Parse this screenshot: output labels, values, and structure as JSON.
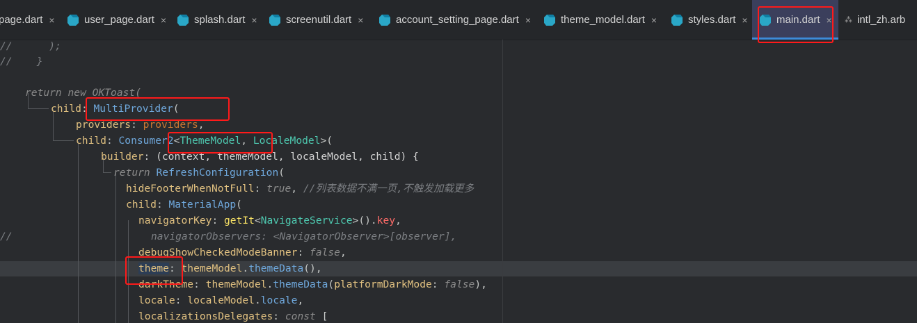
{
  "tabs": [
    {
      "label": "page.dart",
      "active": false
    },
    {
      "label": "user_page.dart",
      "active": false
    },
    {
      "label": "splash.dart",
      "active": false
    },
    {
      "label": "screenutil.dart",
      "active": false
    },
    {
      "label": "account_setting_page.dart",
      "active": false
    },
    {
      "label": "theme_model.dart",
      "active": false
    },
    {
      "label": "styles.dart",
      "active": false
    },
    {
      "label": "main.dart",
      "active": true
    },
    {
      "label": "intl_zh.arb",
      "active": false
    }
  ],
  "close_glyph": "×",
  "arb_glyph": "⁂",
  "code": {
    "l1": {
      "a": "//      );"
    },
    "l2": {
      "a": "//    }"
    },
    "l3": {
      "kw": "return",
      "nw": "new",
      "cls": "OKToast",
      "p": "("
    },
    "l4": {
      "prop": "child",
      "sep": ": ",
      "type": "MultiProvider",
      "p": "("
    },
    "l5": {
      "prop": "providers",
      "sep": ": ",
      "val": "providers",
      "p": ","
    },
    "l6": {
      "prop": "child",
      "sep": ": ",
      "type": "Consumer2",
      "lt": "<",
      "g1": "ThemeModel",
      "comma": ", ",
      "g2": "LocaleModel",
      "gt": ">("
    },
    "l7": {
      "prop": "builder",
      "rest": ": (context, themeModel, localeModel, child) {"
    },
    "l8": {
      "kw": "return",
      "type": "RefreshConfiguration",
      "p": "("
    },
    "l9": {
      "prop": "hideFooterWhenNotFull",
      "sep": ": ",
      "val": "true",
      "p": ", ",
      "cm": "//列表数据不满一页,不触发加载更多"
    },
    "l10": {
      "prop": "child",
      "sep": ": ",
      "type": "MaterialApp",
      "p": "("
    },
    "l11": {
      "prop": "navigatorKey",
      "sep": ": ",
      "fn": "getIt",
      "lt": "<",
      "g": "NavigateService",
      "gt": ">().",
      "red": "key",
      "p": ","
    },
    "l12": {
      "a": "//",
      "b": "navigatorObservers: <NavigatorObserver>[observer],"
    },
    "l13": {
      "prop": "debugShowCheckedModeBanner",
      "sep": ": ",
      "val": "false",
      "p": ","
    },
    "l14": {
      "prop": "theme",
      "sep": ": ",
      "obj": "themeModel",
      "dot": ".",
      "m": "themeData",
      "p": "(),"
    },
    "l15": {
      "prop": "darkTheme",
      "sep": ": ",
      "obj": "themeModel",
      "dot": ".",
      "m": "themeData",
      "o": "(",
      "arg": "platformDarkMode",
      "sep2": ": ",
      "val": "false",
      "p": "),"
    },
    "l16": {
      "prop": "locale",
      "sep": ": ",
      "obj": "localeModel",
      "dot": ".",
      "m": "locale",
      "p": ","
    },
    "l17": {
      "prop": "localizationsDelegates",
      "sep": ": ",
      "kw": "const",
      "p": " ["
    }
  },
  "colors": {
    "highlight_box": "#ff1a1a",
    "active_tab": "#3b3f5c",
    "active_underline": "#3d8bd9",
    "dart_icon": "#2aa7c7"
  }
}
